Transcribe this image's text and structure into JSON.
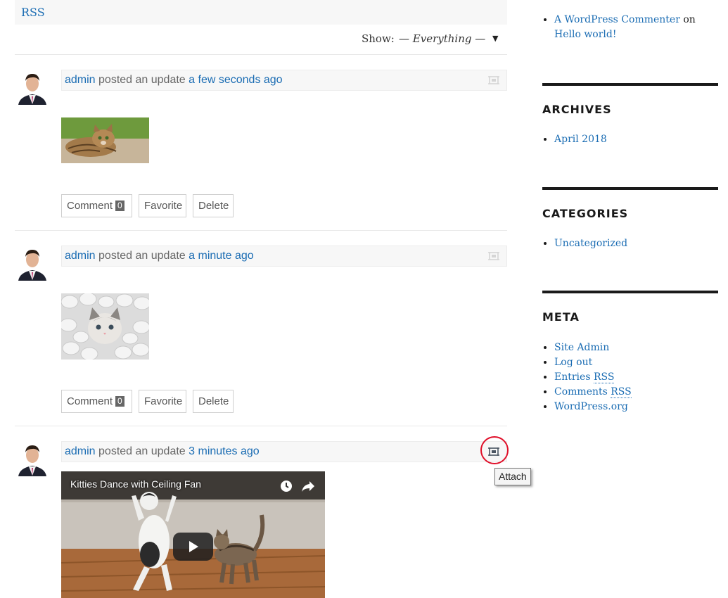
{
  "header": {
    "rss_label": "RSS",
    "show_label": "Show:",
    "show_value": "— Everything —",
    "show_arrow": "▼"
  },
  "activities": [
    {
      "user": "admin",
      "action": "posted an update",
      "time": "a few seconds ago",
      "image": "cat-lying-photo",
      "buttons": {
        "comment": "Comment",
        "comment_count": "0",
        "favorite": "Favorite",
        "delete": "Delete"
      }
    },
    {
      "user": "admin",
      "action": "posted an update",
      "time": "a minute ago",
      "image": "kitten-in-marshmallows-photo",
      "buttons": {
        "comment": "Comment",
        "comment_count": "0",
        "favorite": "Favorite",
        "delete": "Delete"
      }
    },
    {
      "user": "admin",
      "action": "posted an update",
      "time": "3 minutes ago",
      "video_title": "Kitties Dance with Ceiling Fan"
    }
  ],
  "tooltip": "Attach",
  "sidebar": {
    "recent_comment": {
      "author": "A WordPress Commenter",
      "on": "on",
      "post": "Hello world!"
    },
    "archives": {
      "title": "ARCHIVES",
      "items": [
        "April 2018"
      ]
    },
    "categories": {
      "title": "CATEGORIES",
      "items": [
        "Uncategorized"
      ]
    },
    "meta": {
      "title": "META",
      "site_admin": "Site Admin",
      "log_out": "Log out",
      "entries_prefix": "Entries",
      "entries_rss": "RSS",
      "comments_prefix": "Comments",
      "comments_rss": "RSS",
      "wordpress_org": "WordPress.org"
    }
  },
  "colors": {
    "link": "#1a6cb3",
    "highlight_circle": "#e0102a",
    "header_bg": "#f7f7f7"
  }
}
